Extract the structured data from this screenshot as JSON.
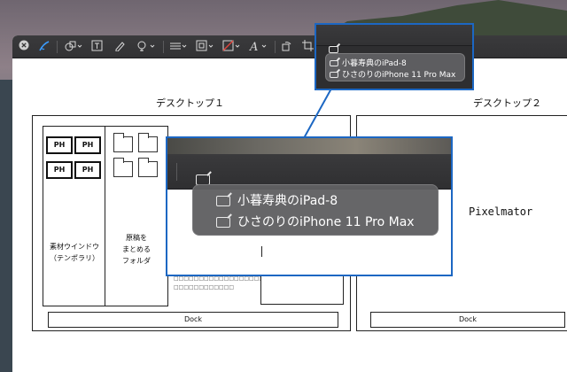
{
  "toolbar": {
    "icons": [
      "close-icon",
      "sketch-icon",
      "shapes-icon",
      "text-icon",
      "sign-icon",
      "adjust-color-icon",
      "line-style-icon",
      "border-color-icon",
      "fill-color-icon",
      "text-style-icon",
      "rotate-icon",
      "crop-icon",
      "share-to-device-icon"
    ]
  },
  "desktops": {
    "desktop1_title": "デスクトップ１",
    "desktop2_title": "デスクトップ２",
    "dock_label": "Dock",
    "ph_label": "PH",
    "material_window_label_1": "素材ウインドウ",
    "material_window_label_2": "（テンポラリ）",
    "manuscript_folder_label_1": "原稿を",
    "manuscript_folder_label_2": "まとめる",
    "manuscript_folder_label_3": "フォルダ",
    "pixelmator_label": "Pixelmator",
    "text_placeholder_1": "□□□□□□□□□□□□□□□□□□□□□",
    "text_placeholder_2": "□□□□□□□□□□□□"
  },
  "device_menu": {
    "items": [
      "小暮寿典のiPad-8",
      "ひさのりのiPhone 11 Pro Max"
    ]
  },
  "colors": {
    "callout_border": "#1c67c3",
    "toolbar_bg": "#323234",
    "menu_bg": "#606062"
  }
}
